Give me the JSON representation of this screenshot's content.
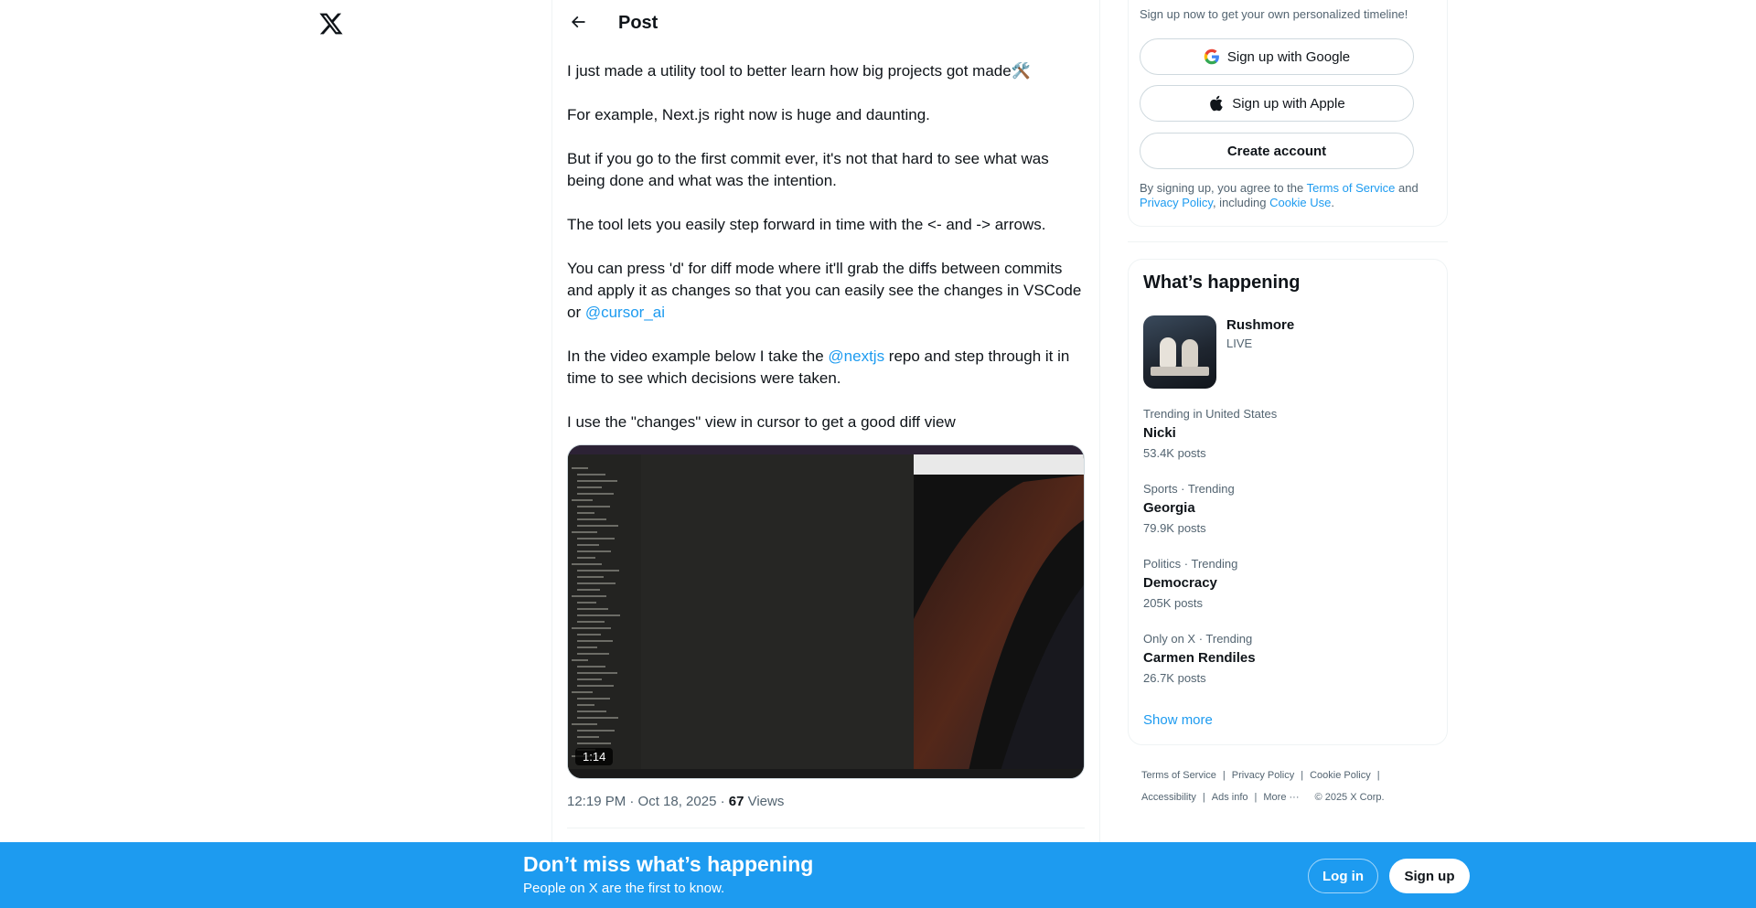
{
  "nav": {
    "logo_icon": "x-logo-icon"
  },
  "header": {
    "title": "Post",
    "back_icon": "arrow-left-icon"
  },
  "tweet": {
    "paragraphs": [
      {
        "text": "I just made a utility tool to better learn how big projects got made🛠️"
      },
      {
        "text": "For example, Next.js right now is huge and daunting."
      },
      {
        "text": "But if you go to the first commit ever, it's not that hard to see what was being done and what was the intention."
      },
      {
        "text": "The tool lets you easily step forward in time with the <- and -> arrows."
      },
      {
        "before": "You can press 'd' for diff mode where it'll grab the diffs between commits and apply it as changes so that you can easily see the changes in VSCode or ",
        "mention": "@cursor_ai"
      },
      {
        "before": "In the video example below I take the ",
        "mention": "@nextjs",
        "after": " repo and step through it in time to see which decisions were taken."
      },
      {
        "text": "I use the \"changes\" view in cursor to get a good diff view"
      }
    ],
    "video": {
      "duration": "1:14"
    },
    "timestamp": "12:19 PM · Oct 18, 2025 · ",
    "views_count": "67",
    "views_label": " Views"
  },
  "signup": {
    "subtitle": "Sign up now to get your own personalized timeline!",
    "google_label": "Sign up with Google",
    "apple_label": "Sign up with Apple",
    "create_label": "Create account",
    "terms_prefix": "By signing up, you agree to the ",
    "terms_link": "Terms of Service",
    "terms_and": " and ",
    "privacy_link": "Privacy Policy",
    "including": ", including ",
    "cookie_link": "Cookie Use",
    "period": "."
  },
  "trends": {
    "title": "What’s happening",
    "live": {
      "name": "Rushmore",
      "badge": "LIVE"
    },
    "items": [
      {
        "category": "Trending in United States",
        "name": "Nicki",
        "count": "53.4K posts"
      },
      {
        "category": "Sports · Trending",
        "name": "Georgia",
        "count": "79.9K posts"
      },
      {
        "category": "Politics · Trending",
        "name": "Democracy",
        "count": "205K posts"
      },
      {
        "category": "Only on X · Trending",
        "name": "Carmen Rendiles",
        "count": "26.7K posts"
      }
    ],
    "show_more": "Show more"
  },
  "footer": {
    "terms": "Terms of Service",
    "privacy": "Privacy Policy",
    "cookie": "Cookie Policy",
    "accessibility": "Accessibility",
    "ads": "Ads info",
    "more": "More ···",
    "copyright": "© 2025 X Corp."
  },
  "banner": {
    "title": "Don’t miss what’s happening",
    "subtitle": "People on X are the first to know.",
    "login_label": "Log in",
    "signup_label": "Sign up"
  },
  "colors": {
    "accent": "#1d9bf0",
    "text": "#0f1419",
    "secondary": "#536471",
    "border": "#eff3f4"
  }
}
